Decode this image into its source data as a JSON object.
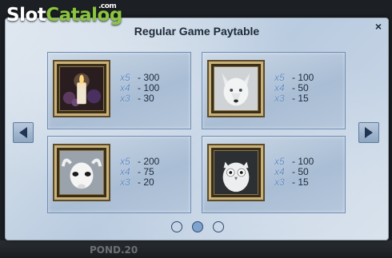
{
  "watermark": {
    "slot": "Slot",
    "catalog": "Catalog",
    "com": ".com"
  },
  "paytable": {
    "title": "Regular Game Paytable",
    "close_icon": "×",
    "symbols": [
      {
        "icon": "candle-icon",
        "pays": [
          {
            "mult": "x5",
            "value": "- 300"
          },
          {
            "mult": "x4",
            "value": "- 100"
          },
          {
            "mult": "x3",
            "value": "- 30"
          }
        ]
      },
      {
        "icon": "wolf-icon",
        "pays": [
          {
            "mult": "x5",
            "value": "- 100"
          },
          {
            "mult": "x4",
            "value": "- 50"
          },
          {
            "mult": "x3",
            "value": "- 15"
          }
        ]
      },
      {
        "icon": "goat-icon",
        "pays": [
          {
            "mult": "x5",
            "value": "- 200"
          },
          {
            "mult": "x4",
            "value": "- 75"
          },
          {
            "mult": "x3",
            "value": "- 20"
          }
        ]
      },
      {
        "icon": "owl-icon",
        "pays": [
          {
            "mult": "x5",
            "value": "- 100"
          },
          {
            "mult": "x4",
            "value": "- 50"
          },
          {
            "mult": "x3",
            "value": "- 15"
          }
        ]
      }
    ],
    "pages": {
      "count": 3,
      "current": 2
    }
  },
  "background_text": "POND.20",
  "colors": {
    "panel": "#c8d6e5",
    "card": "#a9bdd4",
    "frame_gold": "#c8b27a",
    "logo_green": "#8bc53f"
  }
}
